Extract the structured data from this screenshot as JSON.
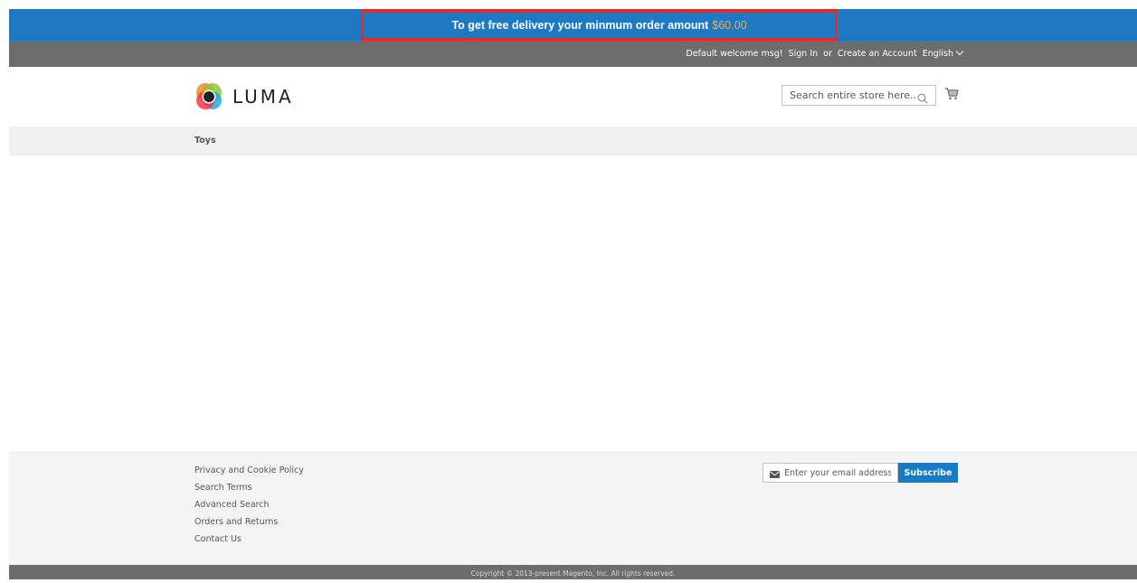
{
  "promo": {
    "text": "To get free delivery your minmum order amount",
    "amount": "$60.00"
  },
  "topbar": {
    "welcome": "Default welcome msg!",
    "sign_in": "Sign In",
    "or": "or",
    "create_account": "Create an Account",
    "language": "English"
  },
  "header": {
    "logo_text": "LUMA",
    "search_placeholder": "Search entire store here...",
    "icons": [
      "luma-logo-icon",
      "search-icon",
      "cart-icon"
    ]
  },
  "nav": {
    "items": [
      {
        "label": "Toys"
      }
    ]
  },
  "footer": {
    "links": [
      {
        "label": "Privacy and Cookie Policy"
      },
      {
        "label": "Search Terms"
      },
      {
        "label": "Advanced Search"
      },
      {
        "label": "Orders and Returns"
      },
      {
        "label": "Contact Us"
      }
    ],
    "newsletter": {
      "placeholder": "Enter your email address",
      "button": "Subscribe"
    },
    "copyright": "Copyright © 2013-present Magento, Inc. All rights reserved."
  },
  "colors": {
    "promo_bg": "#1e78c2",
    "promo_border": "#e02b27",
    "amount": "#f0b03a",
    "topbar_bg": "#6d6d6d",
    "button_blue": "#1979c3"
  }
}
